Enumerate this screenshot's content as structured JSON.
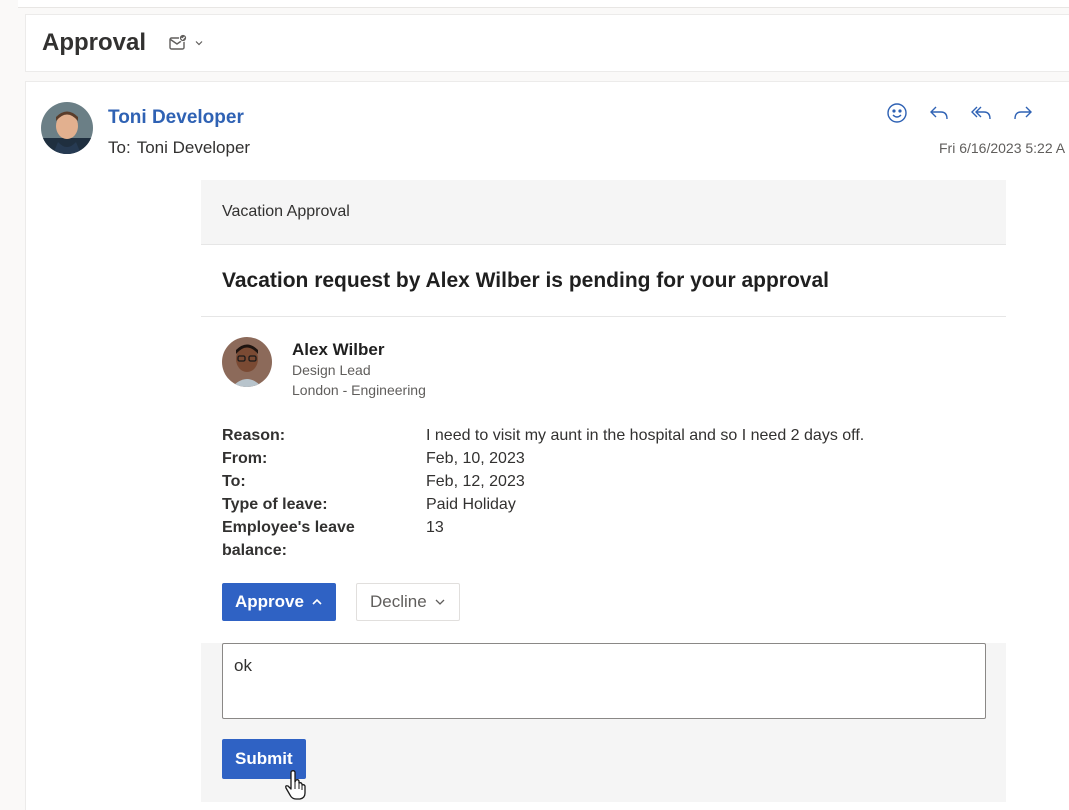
{
  "subject": {
    "title": "Approval",
    "icons": [
      "approval-mail-icon",
      "chevron-down-icon"
    ]
  },
  "message": {
    "sender_name": "Toni Developer",
    "to_label": "To:",
    "to_value": "Toni Developer",
    "date": "Fri 6/16/2023 5:22 A",
    "actions": [
      "emoji-icon",
      "reply-icon",
      "reply-all-icon",
      "forward-icon"
    ]
  },
  "card": {
    "header": "Vacation Approval",
    "title": "Vacation request by Alex Wilber is pending for your approval",
    "employee": {
      "name": "Alex Wilber",
      "role": "Design Lead",
      "location": "London - Engineering"
    },
    "facts": [
      {
        "key": "Reason:",
        "value": "I need to visit my aunt in the hospital and so I need 2 days off."
      },
      {
        "key": "From:",
        "value": "Feb, 10, 2023"
      },
      {
        "key": "To:",
        "value": "Feb, 12, 2023"
      },
      {
        "key": "Type of leave:",
        "value": "Paid Holiday"
      },
      {
        "key": "Employee's leave balance:",
        "value": "13"
      }
    ],
    "approve_label": "Approve",
    "decline_label": "Decline",
    "comment_value": "ok",
    "submit_label": "Submit"
  },
  "colors": {
    "accent": "#2f62c4",
    "link": "#2f62b4"
  }
}
